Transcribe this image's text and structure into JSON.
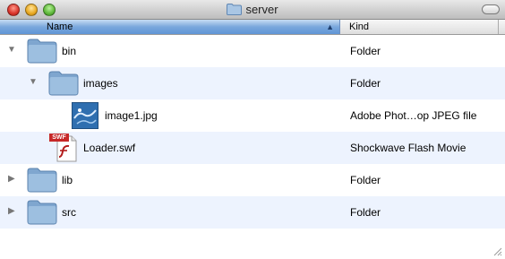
{
  "window": {
    "title": "server"
  },
  "columns": {
    "name": "Name",
    "kind": "Kind"
  },
  "rows": [
    {
      "name": "bin",
      "kind": "Folder",
      "disclosure": "expanded",
      "icon": "folder-icon"
    },
    {
      "name": "images",
      "kind": "Folder",
      "disclosure": "expanded",
      "icon": "folder-icon"
    },
    {
      "name": "image1.jpg",
      "kind": "Adobe Phot…op JPEG file",
      "disclosure": "none",
      "icon": "image-file-icon"
    },
    {
      "name": "Loader.swf",
      "kind": "Shockwave Flash Movie",
      "disclosure": "none",
      "icon": "swf-file-icon",
      "badge": "SWF"
    },
    {
      "name": "lib",
      "kind": "Folder",
      "disclosure": "collapsed",
      "icon": "folder-icon"
    },
    {
      "name": "src",
      "kind": "Folder",
      "disclosure": "collapsed",
      "icon": "folder-icon"
    }
  ],
  "colors": {
    "row_stripe": "#edf3fe",
    "header_selected": "#7aa7dc",
    "folder_blue": "#8fb2d6"
  }
}
